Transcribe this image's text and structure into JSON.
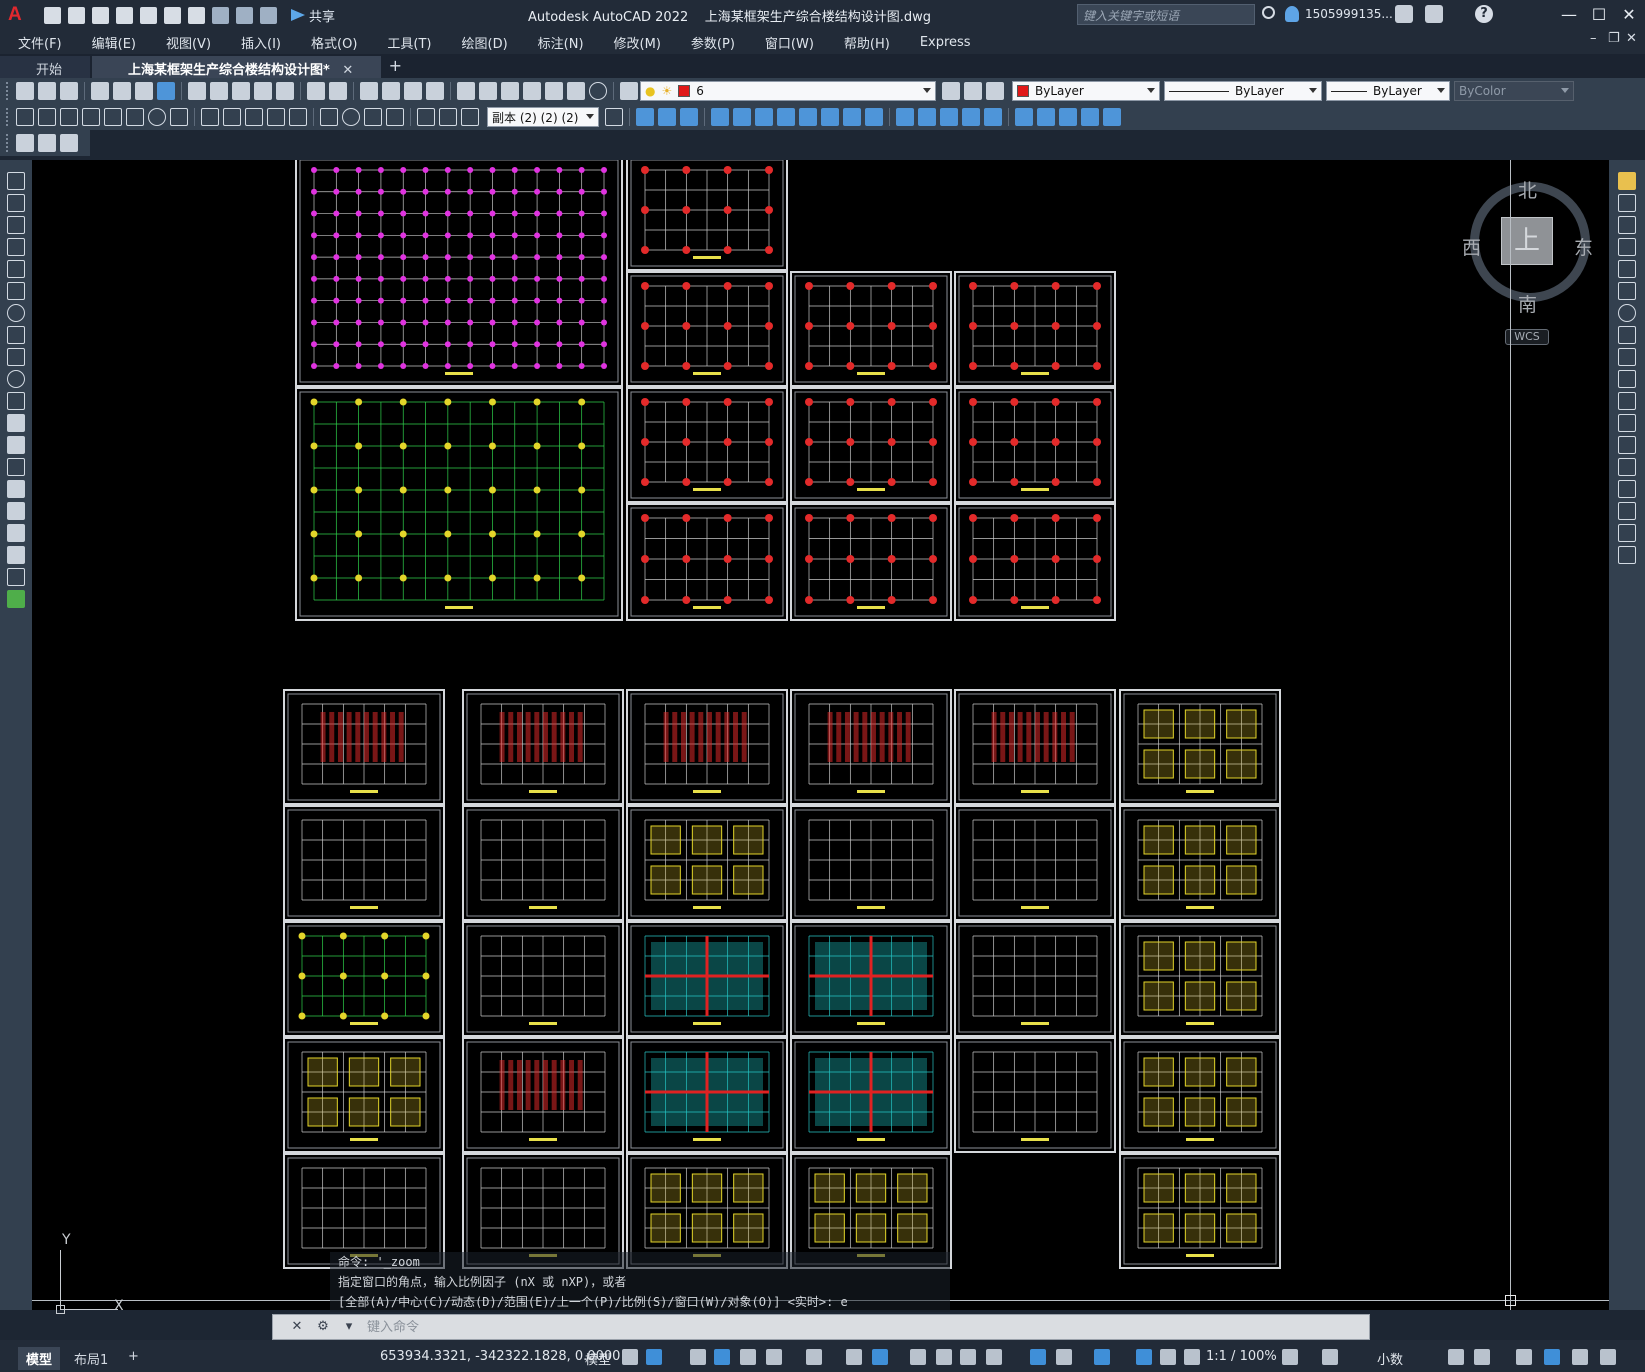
{
  "title_bar": {
    "app_name": "Autodesk AutoCAD 2022",
    "doc_name": "上海某框架生产综合楼结构设计图.dwg",
    "share_label": "共享",
    "search_placeholder": "键入关键字或短语",
    "user_name": "1505999135...",
    "help_label": "?",
    "min": "—",
    "max": "☐",
    "close": "✕"
  },
  "menu": [
    "文件(F)",
    "编辑(E)",
    "视图(V)",
    "插入(I)",
    "格式(O)",
    "工具(T)",
    "绘图(D)",
    "标注(N)",
    "修改(M)",
    "参数(P)",
    "窗口(W)",
    "帮助(H)",
    "Express"
  ],
  "tabs": {
    "start": "开始",
    "active": "上海某框架生产综合楼结构设计图*",
    "close": "✕",
    "add": "+"
  },
  "toolbar": {
    "layer_value": "6",
    "color_value": "ByLayer",
    "linetype_value": "ByLayer",
    "lineweight_value": "ByLayer",
    "plotstyle_value": "ByColor",
    "dimstyle_value": "副本 (2) (2) (2)"
  },
  "viewcube": {
    "top": "北",
    "bottom": "南",
    "left": "西",
    "right": "东",
    "face": "上",
    "wcs": "WCS"
  },
  "ucs": {
    "x": "X",
    "y": "Y"
  },
  "command": {
    "history": [
      "命令: '_zoom",
      "指定窗口的角点，输入比例因子 (nX 或 nXP)，或者",
      "[全部(A)/中心(C)/动态(D)/范围(E)/上一个(P)/比例(S)/窗口(W)/对象(O)] <实时>: e"
    ],
    "placeholder": "键入命令"
  },
  "status": {
    "model_tab": "模型",
    "layout_tab": "布局1",
    "add_tab": "+",
    "coordinates": "653934.3321, -342322.1828, 0.0000",
    "space": "模型",
    "annotation_scale": "1:1 / 100%",
    "units": "小数"
  },
  "colors": {
    "canvas": "#000000",
    "chrome": "#33404f",
    "titlebar": "#222b38",
    "accent": "#3f8fd8"
  }
}
